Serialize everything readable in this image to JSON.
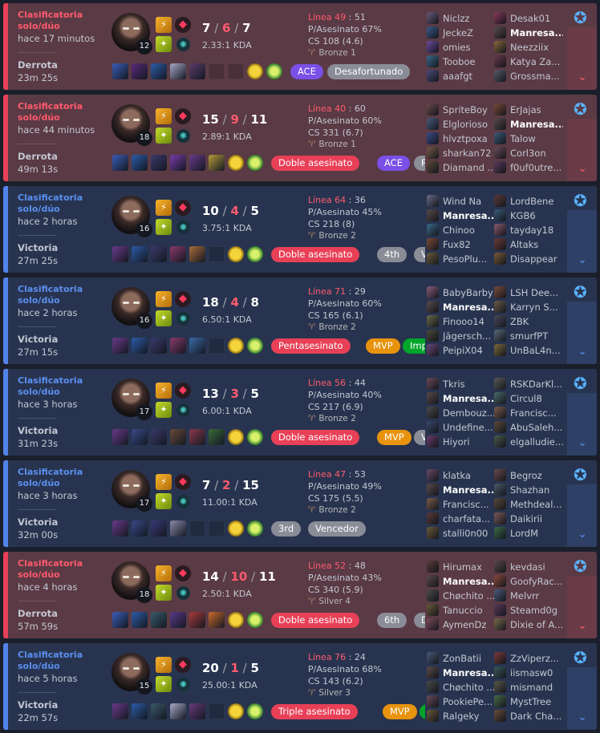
{
  "labels": {
    "kda_suffix": "KDA",
    "line_prefix": "Línea",
    "kp_prefix": "P/Asesinato",
    "cs_prefix": "CS"
  },
  "icons": {
    "ai_button": "robot-sparkle-icon",
    "expand": "chevron-down-icon",
    "spell1": "flash-icon",
    "spell2": "ignite-icon",
    "rune1": "domination-rune-icon",
    "rune2": "secondary-rune-icon",
    "champion": "champion-portrait"
  },
  "colors": {
    "loss_bg": "#5a3a44",
    "win_bg": "#28344f",
    "loss_accent": "#e84057",
    "win_accent": "#5383e8",
    "death_red": "#ff5a6e",
    "tag_red": "#e84057",
    "tag_purple": "#7a50e6",
    "tag_gray": "#8a8d97",
    "tag_orange": "#e8930d",
    "tag_green": "#00a62a"
  },
  "matches": [
    {
      "result_type": "loss",
      "queue": "Clasificatoria solo/dúo",
      "time_ago": "hace 17 minutos",
      "result": "Derrota",
      "duration": "23m 25s",
      "level": "12",
      "kills": "7",
      "deaths": "6",
      "assists": "7",
      "kda_ratio": "2.33:1",
      "line_label": "Línea 49",
      "line_value": "51",
      "kill_participation": "P/Asesinato 67%",
      "cs": "CS 108 (4.6)",
      "tier": "Bronze 1",
      "items": [
        "#3a5db8",
        "#5a2a7a",
        "#2c5ca8",
        "#a8a8c8",
        "#5c3c6a",
        "empty",
        "empty",
        "ward",
        "ward-green"
      ],
      "tags": [
        {
          "text": "ACE",
          "color": "purple"
        },
        {
          "text": "Desafortunado",
          "color": "gray"
        }
      ],
      "team1": [
        {
          "name": "Niclzz",
          "color": "#6a5a7a"
        },
        {
          "name": "JeckeZ",
          "color": "#3a5a8a"
        },
        {
          "name": "omies",
          "color": "#6a4aa0"
        },
        {
          "name": "Tooboe",
          "color": "#3a6a8a"
        },
        {
          "name": "aaafgt",
          "color": "#4a4a7a"
        }
      ],
      "team2": [
        {
          "name": "Desak01",
          "color": "#8a3a5a"
        },
        {
          "name": "Manresa...",
          "color": "#5a4a4a",
          "me": true
        },
        {
          "name": "Neezziix",
          "color": "#8a6a3a"
        },
        {
          "name": "Katya Za...",
          "color": "#6a3a4a"
        },
        {
          "name": "Grossma...",
          "color": "#5a5a6a"
        }
      ]
    },
    {
      "result_type": "loss",
      "queue": "Clasificatoria solo/dúo",
      "time_ago": "hace 44 minutos",
      "result": "Derrota",
      "duration": "49m 13s",
      "level": "18",
      "kills": "15",
      "deaths": "9",
      "assists": "11",
      "kda_ratio": "2.89:1",
      "line_label": "Línea 40",
      "line_value": "60",
      "kill_participation": "P/Asesinato 60%",
      "cs": "CS 331 (6.7)",
      "tier": "Bronze 1",
      "items": [
        "#3a5db8",
        "#2c5ca8",
        "#3a3a6a",
        "#7a3aa8",
        "#6a3a8a",
        "#b89a3a",
        "ward",
        "ward-green"
      ],
      "tags": [
        {
          "text": "Doble asesinato",
          "color": "red"
        },
        {
          "text": "ACE",
          "color": "purple"
        },
        {
          "text": "Promedio",
          "color": "gray"
        }
      ],
      "team1": [
        {
          "name": "SpriteBoy",
          "color": "#6a4a4a"
        },
        {
          "name": "Elglorioso",
          "color": "#4a5a7a"
        },
        {
          "name": "hlvztpoxa",
          "color": "#3a4a8a"
        },
        {
          "name": "sharkan72",
          "color": "#7a5a4a"
        },
        {
          "name": "Diamand ...",
          "color": "#5a4a3a"
        }
      ],
      "team2": [
        {
          "name": "ErJajas",
          "color": "#7a4a3a"
        },
        {
          "name": "Manresa...",
          "color": "#5a4a4a",
          "me": true
        },
        {
          "name": "Talow",
          "color": "#3a5a7a"
        },
        {
          "name": "Corl3on",
          "color": "#6a4a5a"
        },
        {
          "name": "f0uf0utre...",
          "color": "#5a3a5a"
        }
      ]
    },
    {
      "result_type": "win",
      "queue": "Clasificatoria solo/dúo",
      "time_ago": "hace 2 horas",
      "result": "Victoria",
      "duration": "27m 25s",
      "level": "16",
      "kills": "10",
      "deaths": "4",
      "assists": "5",
      "kda_ratio": "3.75:1",
      "line_label": "Línea 64",
      "line_value": "36",
      "kill_participation": "P/Asesinato 45%",
      "cs": "CS 218 (8)",
      "tier": "Bronze 2",
      "items": [
        "#6a3a8a",
        "#2c5ca8",
        "#3a3a6a",
        "#8a3a6a",
        "#a86a3a",
        "empty",
        "ward",
        "ward-green"
      ],
      "tags": [
        {
          "text": "Doble asesinato",
          "color": "red"
        },
        {
          "text": "4th",
          "color": "gray"
        },
        {
          "text": "Vencedor",
          "color": "gray"
        }
      ],
      "team1": [
        {
          "name": "Wind Na",
          "color": "#6a6a8a"
        },
        {
          "name": "Manresa...",
          "color": "#5a4a4a",
          "me": true
        },
        {
          "name": "Chinoo",
          "color": "#3a6a8a"
        },
        {
          "name": "Fux82",
          "color": "#7a4a3a"
        },
        {
          "name": "PesoPlu...",
          "color": "#6a5a3a"
        }
      ],
      "team2": [
        {
          "name": "LordBene",
          "color": "#5a3a3a"
        },
        {
          "name": "KGB6",
          "color": "#3a5a7a"
        },
        {
          "name": "tayday18",
          "color": "#8a5a6a"
        },
        {
          "name": "Altaks",
          "color": "#6a3a3a"
        },
        {
          "name": "Disappear",
          "color": "#7a5a3a"
        }
      ]
    },
    {
      "result_type": "win",
      "queue": "Clasificatoria solo/dúo",
      "time_ago": "hace 2 horas",
      "result": "Victoria",
      "duration": "27m 15s",
      "level": "16",
      "kills": "18",
      "deaths": "4",
      "assists": "8",
      "kda_ratio": "6.50:1",
      "line_label": "Línea 71",
      "line_value": "29",
      "kill_participation": "P/Asesinato 60%",
      "cs": "CS 165 (6.1)",
      "tier": "Bronze 2",
      "items": [
        "#6a3a8a",
        "#2c5ca8",
        "#3a3a6a",
        "#8a3a6a",
        "#3a6aa8",
        "empty",
        "ward",
        "ward-green"
      ],
      "tags": [
        {
          "text": "Pentasesinato",
          "color": "red"
        },
        {
          "text": "MVP",
          "color": "orange"
        },
        {
          "text": "Imparable",
          "color": "green"
        }
      ],
      "team1": [
        {
          "name": "BabyBarby",
          "color": "#8a5a7a"
        },
        {
          "name": "Manresa...",
          "color": "#5a4a4a",
          "me": true
        },
        {
          "name": "Finooo14",
          "color": "#6a6a4a"
        },
        {
          "name": "Jägersch...",
          "color": "#4a4a3a"
        },
        {
          "name": "PeipiX04",
          "color": "#6a4a7a"
        }
      ],
      "team2": [
        {
          "name": "LSH Dee...",
          "color": "#7a4a3a"
        },
        {
          "name": "Karryn S...",
          "color": "#6a5a4a"
        },
        {
          "name": "ZBK",
          "color": "#4a4a5a"
        },
        {
          "name": "smurfPT",
          "color": "#5a6a7a"
        },
        {
          "name": "UnBaL4n...",
          "color": "#7a6a3a"
        }
      ]
    },
    {
      "result_type": "win",
      "queue": "Clasificatoria solo/dúo",
      "time_ago": "hace 3 horas",
      "result": "Victoria",
      "duration": "31m 23s",
      "level": "17",
      "kills": "13",
      "deaths": "3",
      "assists": "5",
      "kda_ratio": "6.00:1",
      "line_label": "Línea 56",
      "line_value": "44",
      "kill_participation": "P/Asesinato 40%",
      "cs": "CS 217 (6.9)",
      "tier": "Bronze 2",
      "items": [
        "#6a3a8a",
        "#3a4a8a",
        "#3a3a6a",
        "#6a4a3a",
        "#8a3a4a",
        "#3a6a3a",
        "ward",
        "ward-green"
      ],
      "tags": [
        {
          "text": "Doble asesinato",
          "color": "red"
        },
        {
          "text": "MVP",
          "color": "orange"
        },
        {
          "text": "Vencedor",
          "color": "gray"
        }
      ],
      "team1": [
        {
          "name": "Tkris",
          "color": "#6a4a5a"
        },
        {
          "name": "Manresa...",
          "color": "#5a4a4a",
          "me": true
        },
        {
          "name": "Dembouz...",
          "color": "#4a4a4a"
        },
        {
          "name": "Undefine...",
          "color": "#3a4a6a"
        },
        {
          "name": "Hiyori",
          "color": "#6a3a6a"
        }
      ],
      "team2": [
        {
          "name": "RSKDarKl...",
          "color": "#5a5a5a"
        },
        {
          "name": "Circul8",
          "color": "#4a6a6a"
        },
        {
          "name": "Francisc...",
          "color": "#7a5a4a"
        },
        {
          "name": "AbuSaleh...",
          "color": "#5a4a3a"
        },
        {
          "name": "elgalludie...",
          "color": "#4a5a4a"
        }
      ]
    },
    {
      "result_type": "win",
      "queue": "Clasificatoria solo/dúo",
      "time_ago": "hace 3 horas",
      "result": "Victoria",
      "duration": "32m 00s",
      "level": "17",
      "kills": "7",
      "deaths": "2",
      "assists": "15",
      "kda_ratio": "11.00:1",
      "line_label": "Línea 47",
      "line_value": "53",
      "kill_participation": "P/Asesinato 49%",
      "cs": "CS 175 (5.5)",
      "tier": "Bronze 2",
      "items": [
        "#6a3a8a",
        "#3a4a8a",
        "#3a3a7a",
        "#8a8aa8",
        "empty",
        "empty",
        "ward",
        "ward-green"
      ],
      "tags": [
        {
          "text": "3rd",
          "color": "gray"
        },
        {
          "text": "Vencedor",
          "color": "gray"
        }
      ],
      "team1": [
        {
          "name": "klatka",
          "color": "#6a4a6a"
        },
        {
          "name": "Manresa...",
          "color": "#5a4a4a",
          "me": true
        },
        {
          "name": "Francisc...",
          "color": "#7a5a4a"
        },
        {
          "name": "charfata...",
          "color": "#5a3a3a"
        },
        {
          "name": "stalli0n00",
          "color": "#6a5a3a"
        }
      ],
      "team2": [
        {
          "name": "Begroz",
          "color": "#6a4a4a"
        },
        {
          "name": "Shazhan",
          "color": "#4a5a6a"
        },
        {
          "name": "Methdeal...",
          "color": "#5a4a3a"
        },
        {
          "name": "Daikirii",
          "color": "#7a5a5a"
        },
        {
          "name": "LordM",
          "color": "#3a6a4a"
        }
      ]
    },
    {
      "result_type": "loss",
      "queue": "Clasificatoria solo/dúo",
      "time_ago": "hace 4 horas",
      "result": "Derrota",
      "duration": "57m 59s",
      "level": "18",
      "kills": "14",
      "deaths": "10",
      "assists": "11",
      "kda_ratio": "2.50:1",
      "line_label": "Línea 52",
      "line_value": "48",
      "kill_participation": "P/Asesinato 43%",
      "cs": "CS 340 (5.9)",
      "tier": "Silver 4",
      "items": [
        "#3a5db8",
        "#2c5ca8",
        "#3a5a6a",
        "#5a3a8a",
        "#a83a3a",
        "#c86a2a",
        "ward",
        "ward-green"
      ],
      "tags": [
        {
          "text": "Doble asesinato",
          "color": "red"
        },
        {
          "text": "6th",
          "color": "gray"
        },
        {
          "text": "Desafortunado",
          "color": "gray"
        }
      ],
      "team1": [
        {
          "name": "Hirumax",
          "color": "#5a3a3a"
        },
        {
          "name": "Manresa...",
          "color": "#5a4a4a",
          "me": true
        },
        {
          "name": "Chøchito ...",
          "color": "#4a4a4a"
        },
        {
          "name": "Tanuccio",
          "color": "#6a5a3a"
        },
        {
          "name": "AymenDz",
          "color": "#7a4a5a"
        }
      ],
      "team2": [
        {
          "name": "kevdasi",
          "color": "#5a4a4a"
        },
        {
          "name": "GoofyRac...",
          "color": "#8a4a3a"
        },
        {
          "name": "Melvrr",
          "color": "#4a5a7a"
        },
        {
          "name": "Steamd0g",
          "color": "#5a3a5a"
        },
        {
          "name": "Dixie of A...",
          "color": "#7a6a4a"
        }
      ]
    },
    {
      "result_type": "win",
      "queue": "Clasificatoria solo/dúo",
      "time_ago": "hace 5 horas",
      "result": "Victoria",
      "duration": "22m 57s",
      "level": "15",
      "kills": "20",
      "deaths": "1",
      "assists": "5",
      "kda_ratio": "25.00:1",
      "line_label": "Línea 76",
      "line_value": "24",
      "kill_participation": "P/Asesinato 68%",
      "cs": "CS 143 (6.2)",
      "tier": "Silver 3",
      "items": [
        "#6a3a8a",
        "#2c5ca8",
        "#3a5a6a",
        "#a8a8c8",
        "#6a3a7a",
        "empty",
        "ward",
        "ward-green"
      ],
      "tags": [
        {
          "text": "Triple asesinato",
          "color": "red"
        },
        {
          "text": "MVP",
          "color": "orange"
        },
        {
          "text": "Imparable",
          "color": "green"
        }
      ],
      "team1": [
        {
          "name": "ZonBatii",
          "color": "#4a5a7a"
        },
        {
          "name": "Manresa...",
          "color": "#5a4a4a",
          "me": true
        },
        {
          "name": "Chøchito ...",
          "color": "#4a4a4a"
        },
        {
          "name": "PookiePe...",
          "color": "#6a4a5a"
        },
        {
          "name": "Ralgeky",
          "color": "#6a5a3a"
        }
      ],
      "team2": [
        {
          "name": "ZzViperz...",
          "color": "#7a3a3a"
        },
        {
          "name": "iismasw0",
          "color": "#3a5a5a"
        },
        {
          "name": "mismand",
          "color": "#5a5a4a"
        },
        {
          "name": "MystTree",
          "color": "#4a6a4a"
        },
        {
          "name": "Dark Cha...",
          "color": "#6a4a3a"
        }
      ]
    }
  ]
}
